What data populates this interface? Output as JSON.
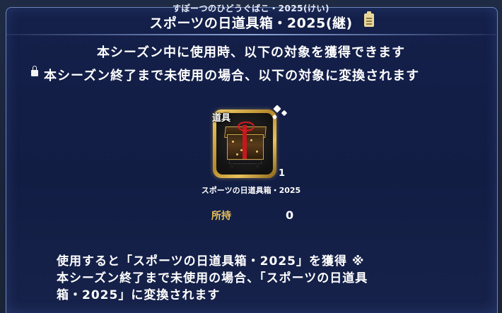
{
  "header": {
    "ruby": "すぽーつのひどうぐばこ・2025(けい)",
    "title": "スポーツの日道具箱・2025(継)",
    "clipboard_icon": "clipboard-icon"
  },
  "info": {
    "line1": "本シーズン中に使用時、以下の対象を獲得できます",
    "line2": "本シーズン終了まで未使用の場合、以下の対象に変換されます",
    "lock_icon": "lock-icon"
  },
  "item": {
    "category_tag": "道具",
    "count": "1",
    "name": "スポーツの日道具箱・2025"
  },
  "owned": {
    "label": "所持",
    "value": "0"
  },
  "description": {
    "line1": "使用すると「スポーツの日道具箱・2025」を獲得 ※",
    "line2": "本シーズン終了まで未使用の場合、「スポーツの日道具",
    "line3": "箱・2025」に変換されます"
  },
  "colors": {
    "accent_gold": "#e7c15a",
    "panel_border": "#6f86b8",
    "ribbon_red": "#c8161d"
  }
}
